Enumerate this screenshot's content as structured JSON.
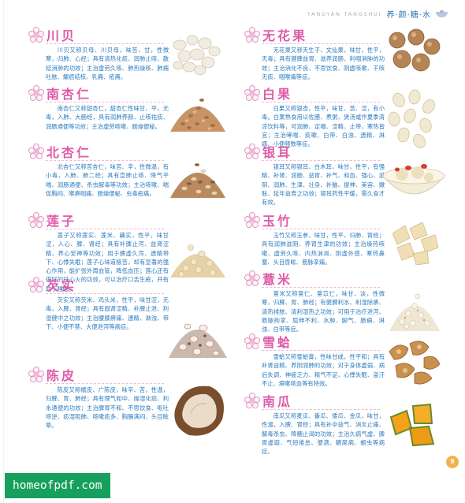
{
  "header": {
    "latin": "YANGYAN TANGSHUI",
    "cn": "养·颜·糖·水",
    "icon": "bowl-icon"
  },
  "entries_left": [
    {
      "title": "川贝",
      "text": "川贝又称贝母、川贝母，味苦、甘，性微寒，归肺、心经；具有清热化痰、润肺止咳、散结消肿的功效；主治虚劳久咳、肺热燥咳、肺痈吐脓、瘰疬结核、乳痈、疮痈。",
      "image": "chuanbei-bulbs"
    },
    {
      "title": "南杏仁",
      "text": "南杏仁又称甜杏仁，甜杏仁性味甘、平，无毒，入肺、大肠经，具有润肺养颜、止咳祛痰、润肠通便等功效；主治虚劳咳嗽、肠燥便秘。",
      "image": "sweet-apricot-kernels"
    },
    {
      "title": "北杏仁",
      "text": "北杏仁又称苦杏仁，味苦、辛，性微温，有小毒，入肺、肺二经；具有宣肺止咳、降气平喘、润肠通便、杀虫解毒等功效；主治咳嗽、喘促胸闷、喉痹咽痛、肠燥便秘、虫毒疮痛。",
      "image": "bitter-apricot-kernels"
    },
    {
      "title": "莲子",
      "text": "莲子又称莲实、莲米、藕实，性平，味甘涩，入心、脾、肾经；具有补脾止泻、益肾涩精、养心安神等功效；用于脾虚久泻、遗精带下、心悸失眠；莲子心味道极苦，却有显著的强心作用，能扩张外周血管，降低血压；莲心还有很好的祛心火的功效，可以治疗口舌生疮，并有助于睡眠。",
      "image": "lotus-seeds"
    },
    {
      "title": "芡实",
      "text": "芡实又称芡米、鸡头米，性平，味甘涩，无毒，入脾、肾经；具有固肾涩精、补脾止泄、利湿健中之功效；主治腰膝痹痛、遗精、淋浊、带下、小便不禁、大便泄泻等病症。",
      "image": "euryale-seeds"
    },
    {
      "title": "陈皮",
      "text": "陈皮又称橘皮、广陈皮，味辛、苦，性温，归脾、胃、肺经；具有理气和中、燥湿化痰、利水通便的功效；主治脾胃不和、不思饮食、呕吐哕逆、痰湿阻肺、咳嗽痰多、胸膈满闷、头目眩晕。",
      "image": "dried-tangerine-peel"
    }
  ],
  "entries_right": [
    {
      "title": "无花果",
      "text": "无花果又称天生子、文仙果，味甘，性平，无毒；具有健脾益胃、滋养润肠、利咽消肿的功效；主治消化不良、不思饮食、阴虚咳嗽、干咳无痰、咽喉痛等症。",
      "image": "dried-figs"
    },
    {
      "title": "白果",
      "text": "白果又称银杏，性平，味甘、苦、涩，有小毒。白果熟食用以佐膳、煮粥、煲汤或作夏季清凉饮料等，可润肺、定喘、涩精、止带，寒热皆宜；主治哮喘、痰嗽、白带、白浊、遗精、淋病、小便频数等症。",
      "image": "ginkgo-nuts"
    },
    {
      "title": "银耳",
      "text": "银耳又称银耳、白木耳，味甘，性平，有强精、补肾、润肠、益胃、补气、和血、强心、滋阴、润肺、生津、壮身、补脑、提神、美容、嫩肤、延年益寿之功效；银耳药性平缓，需久食才有效。",
      "image": "white-fungus-soup"
    },
    {
      "title": "玉竹",
      "text": "玉竹又称玉参，味甘，性平，归肺、胃经；具有润肺滋阴、养胃生津的功效；主治燥热咳嗽、虚劳久咳、内热消渴、阴虚外感、寒热鼻塞、头目昏眩、筋脉挛痛。",
      "image": "polygonatum-slices"
    },
    {
      "title": "薏米",
      "text": "薏米又称薏仁、薏苡仁，味甘、淡，性微寒，归脾、胃、肺经；有健脾利水、利湿除痹、清热排脓、清利湿热之功效；可用于治疗泄泻、筋脉拘挛、屈伸不利、水肿、脚气、肠痈、淋浊、白带等症。",
      "image": "job-tears-seeds"
    },
    {
      "title": "雪蛤",
      "text": "雪蛤又称雪蛤膏，性味甘咸，性平和；具有补肾益精、养阴润肺的功效；对于身体虚弱、病后失调、神疲乏力、精气不足、心悸失眠、盗汗不止、痨嗽咳血等有特效。",
      "image": "snow-frog-fat"
    },
    {
      "title": "南瓜",
      "text": "南瓜又称麦瓜、番瓜、倭瓜、金瓜，味甘，性温，入脾、胃经；具有补中益气、消炎止痛、解毒杀虫、降糖止渴的功效；主治久病气虚、脾胃虚弱、气短倦怠、便溏、糖尿病、蛔虫等病症。",
      "image": "pumpkin-pieces"
    }
  ],
  "page_number": "9",
  "watermark": "homeofpdf.com"
}
